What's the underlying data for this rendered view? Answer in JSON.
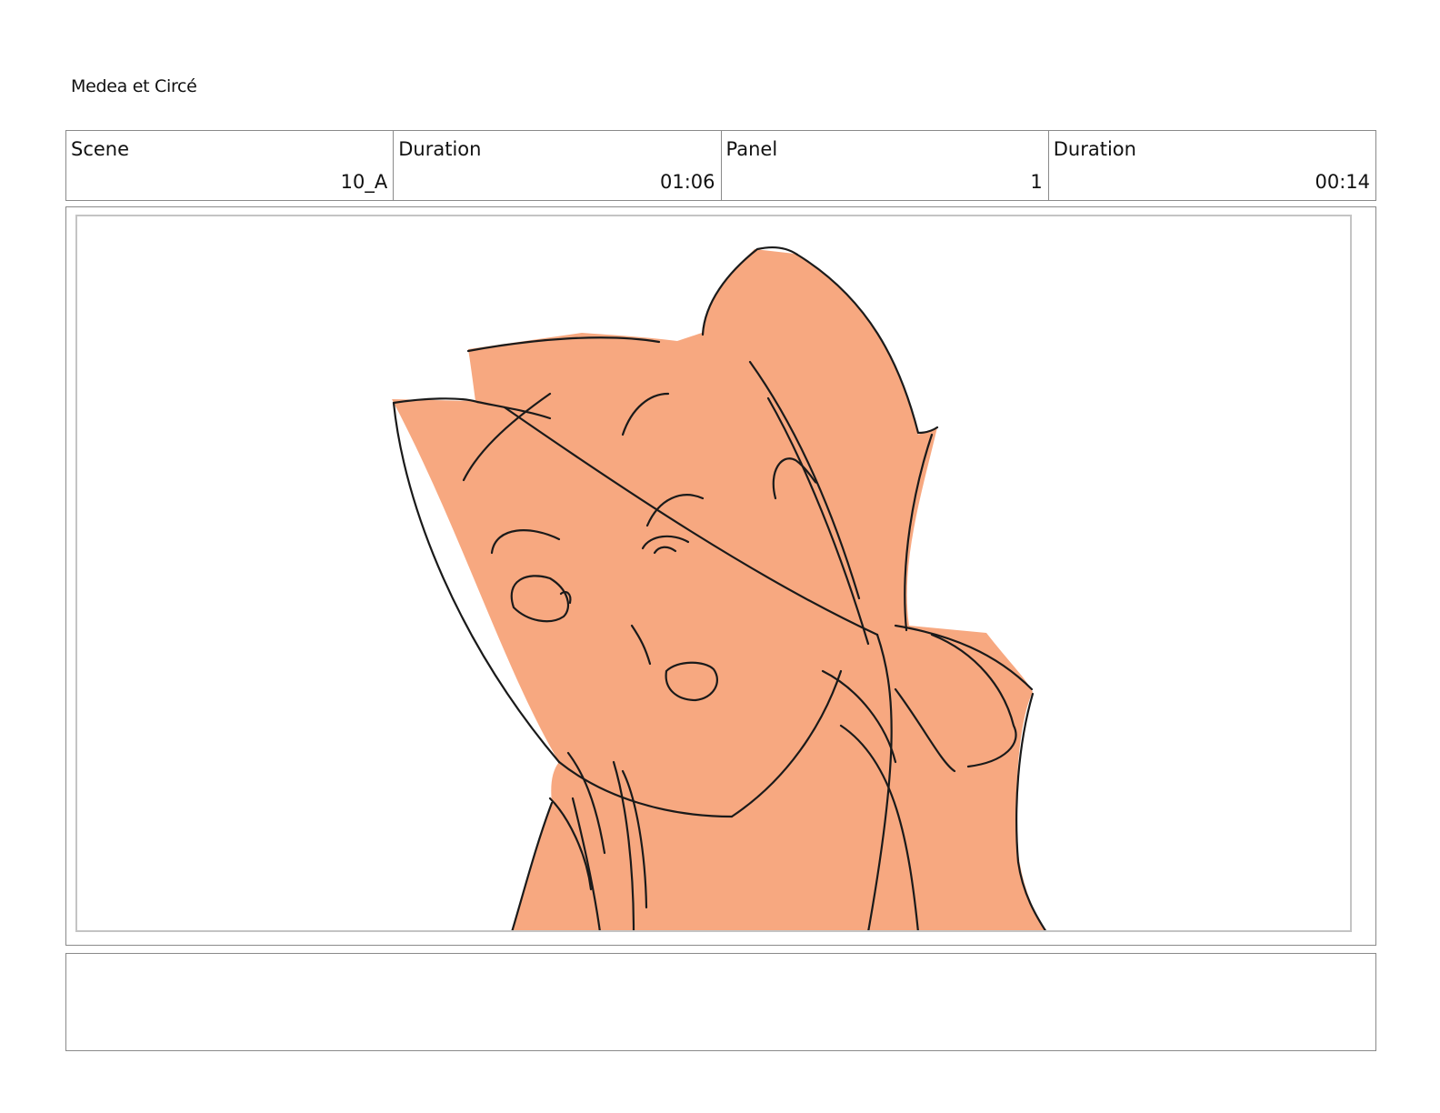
{
  "document": {
    "title": "Medea et Circé"
  },
  "info": {
    "scene_label": "Scene",
    "scene_value": "10_A",
    "duration_label": "Duration",
    "duration_value": "01:06",
    "panel_label": "Panel",
    "panel_value": "1",
    "panel_duration_label": "Duration",
    "panel_duration_value": "00:14"
  },
  "panel": {
    "fill_color": "#f7a880",
    "line_color": "#1a1a1a"
  },
  "notes": {
    "text": ""
  }
}
